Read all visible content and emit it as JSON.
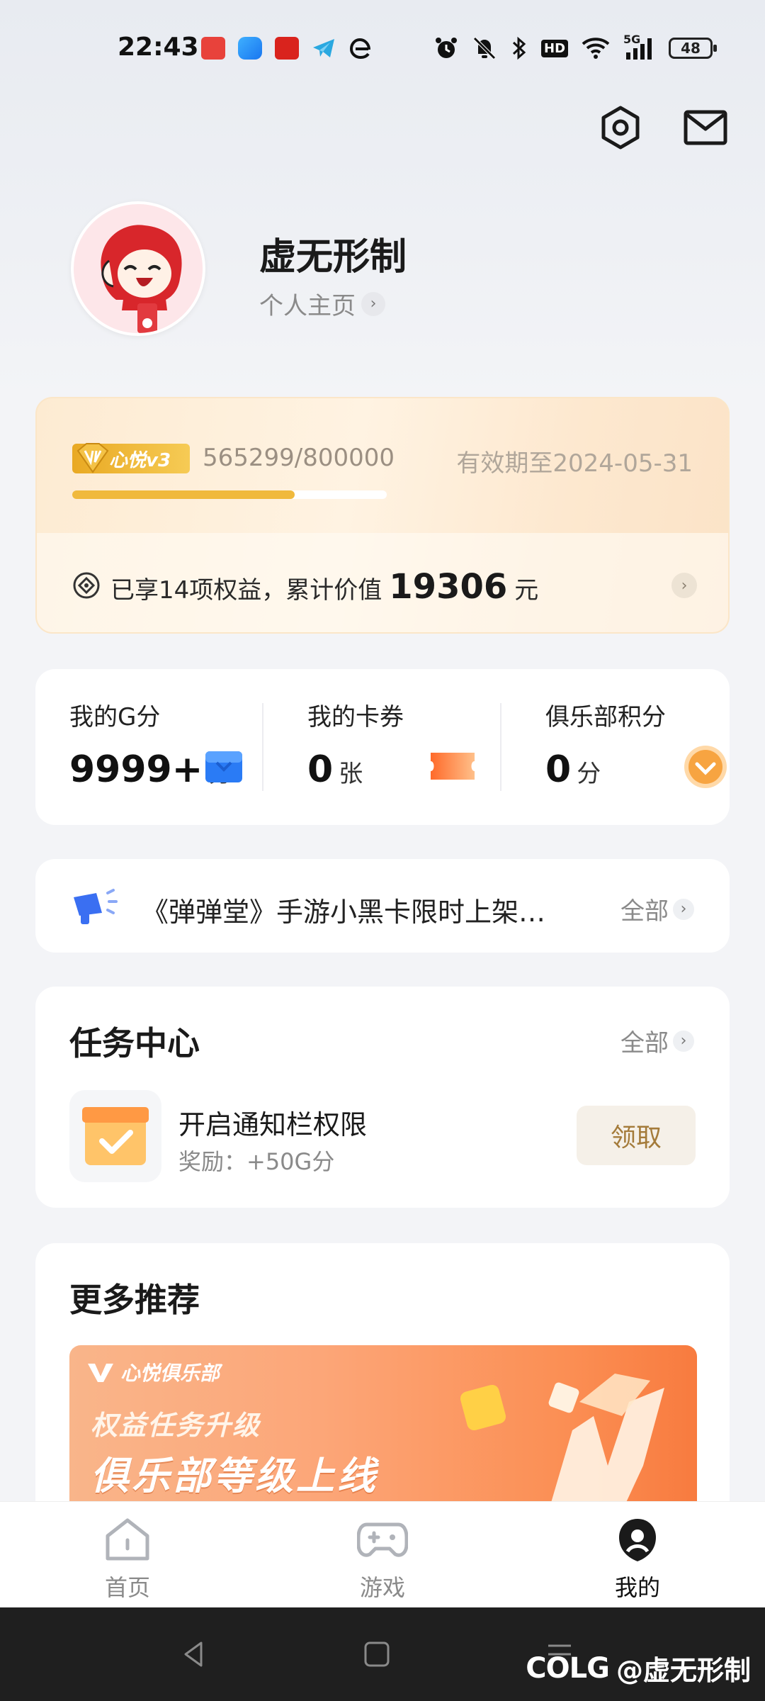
{
  "status_bar": {
    "time": "22:43",
    "network": "5G",
    "battery": "48",
    "hd": "HD",
    "icons": [
      "toutiao-app-icon",
      "blue-app-icon",
      "xuexi-app-icon",
      "telegram-app-icon",
      "edge-app-icon",
      "alarm-icon",
      "mute-icon",
      "bluetooth-icon",
      "hd-icon",
      "wifi-icon",
      "signal-icon",
      "battery-icon"
    ]
  },
  "header": {
    "icons": [
      "settings-icon",
      "mail-icon"
    ]
  },
  "profile": {
    "name": "虚无形制",
    "link_label": "个人主页"
  },
  "vip": {
    "badge_label": "心悦v3",
    "progress_text": "565299/800000",
    "progress_fraction": 0.7066,
    "expiry": "有效期至2024-05-31",
    "benefits_prefix": "已享14项权益，累计价值",
    "benefits_value": "19306",
    "benefits_unit": "元",
    "accent_color": "#f0b93c"
  },
  "stats": [
    {
      "label": "我的G分",
      "value": "9999+",
      "unit": "分"
    },
    {
      "label": "我的卡券",
      "value": "0",
      "unit": "张"
    },
    {
      "label": "俱乐部积分",
      "value": "0",
      "unit": "分"
    }
  ],
  "notice": {
    "text": "《弹弹堂》手游小黑卡限时上架…",
    "all_label": "全部"
  },
  "tasks": {
    "title": "任务中心",
    "all_label": "全部",
    "items": [
      {
        "title": "开启通知栏权限",
        "reward": "奖励：+50G分",
        "action": "领取"
      }
    ]
  },
  "more": {
    "title": "更多推荐",
    "banner": {
      "brand": "心悦俱乐部",
      "line1": "权益任务升级",
      "line2": "俱乐部等级上线"
    }
  },
  "bottom_nav": [
    {
      "label": "首页"
    },
    {
      "label": "游戏"
    },
    {
      "label": "我的"
    }
  ],
  "watermark": {
    "brand": "COLG",
    "handle": "@虚无形制"
  }
}
